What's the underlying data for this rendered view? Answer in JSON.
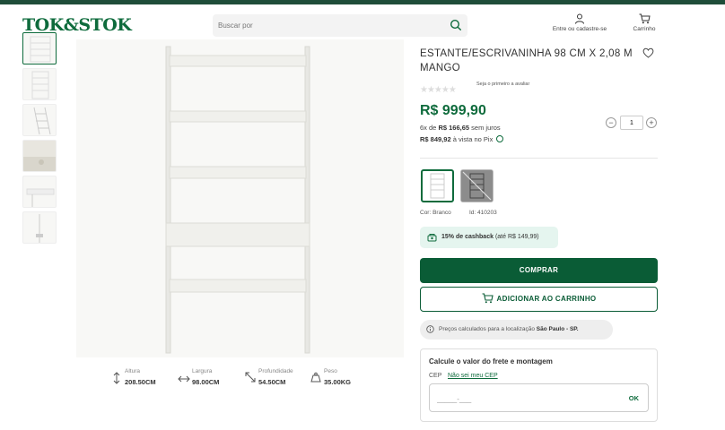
{
  "header": {
    "logo": "TOK&STOK",
    "search_placeholder": "Buscar por",
    "account_label": "Entre ou cadastre-se",
    "cart_label": "Carrinho"
  },
  "gallery": {
    "thumbnail_count": 6,
    "active_index": 0
  },
  "specs": [
    {
      "label": "Altura",
      "value": "208.50CM"
    },
    {
      "label": "Largura",
      "value": "98.00CM"
    },
    {
      "label": "Profundidade",
      "value": "54.50CM"
    },
    {
      "label": "Peso",
      "value": "35.00KG"
    }
  ],
  "product": {
    "title": "ESTANTE/ESCRIVANINHA 98 CM X 2,08 M MANGO",
    "rating_link": "Seja o primeiro a avaliar",
    "price": "R$ 999,90",
    "installments_prefix": "6x de",
    "installments_value": "R$ 166,65",
    "installments_suffix": "sem juros",
    "pix_value": "R$ 849,92",
    "pix_suffix": "à vista no Pix",
    "quantity": "1",
    "color_label": "Cor: Branco",
    "id_label": "Id: 410203",
    "cashback_bold": "15% de cashback",
    "cashback_rest": "(até R$ 149,99)"
  },
  "actions": {
    "buy_label": "COMPRAR",
    "add_to_cart_label": "ADICIONAR AO CARRINHO"
  },
  "location": {
    "prefix": "Preços calculados para a localização",
    "city": "São Paulo - SP."
  },
  "freight": {
    "title": "Calcule o valor do frete e montagem",
    "cep_label": "CEP",
    "cep_link": "Não sei meu CEP",
    "cep_placeholder": "_____-___",
    "ok_label": "OK"
  },
  "colors": {
    "brand_green": "#0e6b3c",
    "button_green": "#0a5c36",
    "cashback_bg": "#e5f5ef"
  }
}
